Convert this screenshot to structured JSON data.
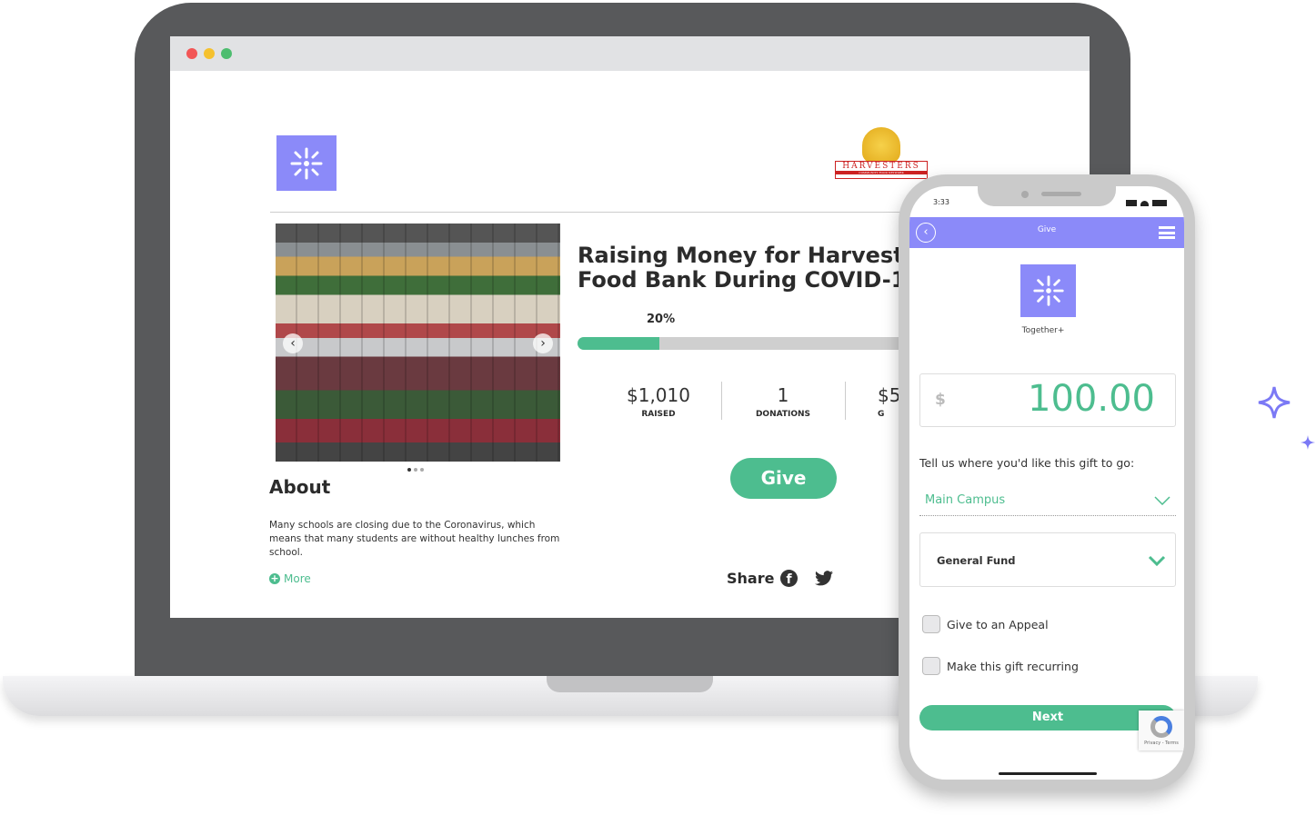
{
  "laptop": {
    "org_logo_alt": "Together+",
    "partner_logo_text": "HARVESTERS",
    "partner_logo_subtext": "COMMUNITY FOOD NETWORK",
    "campaign": {
      "title_line1": "Raising Money for Harvesters",
      "title_line2": "Food Bank During COVID-19",
      "progress_percent": 20,
      "progress_label": "20%"
    },
    "stats": [
      {
        "value": "$1,010",
        "label": "RAISED"
      },
      {
        "value": "1",
        "label": "DONATIONS"
      },
      {
        "value": "$5",
        "label": "G"
      }
    ],
    "give_label": "Give",
    "about": {
      "heading": "About",
      "body": "Many schools are closing due to the Coronavirus, which means that many students are without healthy lunches from school.",
      "more_label": "More"
    },
    "share_label": "Share",
    "carousel_count": 3,
    "carousel_active": 0
  },
  "phone": {
    "status": {
      "time": "3:33"
    },
    "header_title": "Give",
    "org_name": "Together+",
    "amount": {
      "currency": "$",
      "value": "100.00"
    },
    "destination_prompt": "Tell us where you'd like this gift to go:",
    "campus_select": "Main Campus",
    "fund_select": "General Fund",
    "checkboxes": [
      {
        "label": "Give to an Appeal",
        "checked": false
      },
      {
        "label": "Make this gift recurring",
        "checked": false
      }
    ],
    "next_label": "Next",
    "recaptcha_text": "Privacy - Terms"
  },
  "colors": {
    "accent_green": "#4dbd8f",
    "brand_purple": "#8b8af9"
  }
}
